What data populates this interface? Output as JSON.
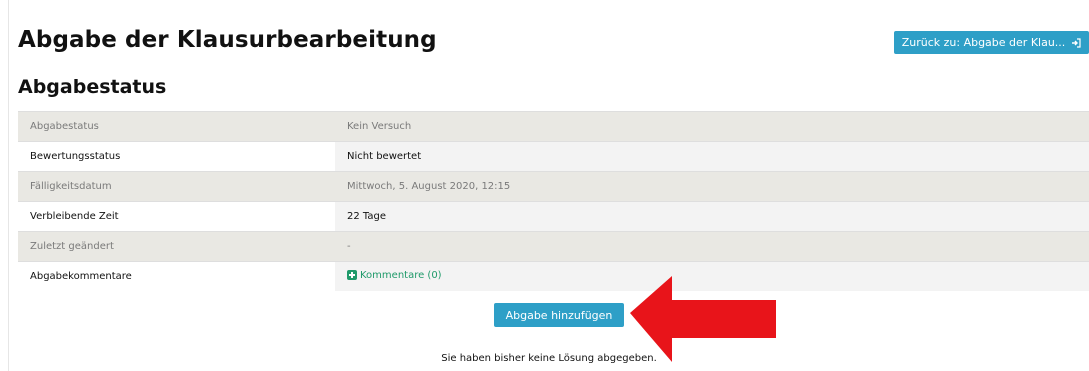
{
  "header": {
    "title": "Abgabe der Klausurbearbeitung",
    "back_button_label": "Zurück zu: Abgabe der Klau...",
    "back_icon": "sign-in-icon"
  },
  "section": {
    "title": "Abgabestatus"
  },
  "status_rows": [
    {
      "label": "Abgabestatus",
      "value": "Kein Versuch"
    },
    {
      "label": "Bewertungsstatus",
      "value": "Nicht bewertet"
    },
    {
      "label": "Fälligkeitsdatum",
      "value": "Mittwoch, 5. August 2020, 12:15"
    },
    {
      "label": "Verbleibende Zeit",
      "value": "22 Tage"
    },
    {
      "label": "Zuletzt geändert",
      "value": "-"
    },
    {
      "label": "Abgabekommentare",
      "value": "Kommentare (0)",
      "icon": "plus-square-icon"
    }
  ],
  "actions": {
    "add_submission_label": "Abgabe hinzufügen"
  },
  "footer_note": "Sie haben bisher keine Lösung abgegeben.",
  "annotation": {
    "arrow_color": "#e8141a",
    "arrow_icon": "red-arrow-pointing-left"
  },
  "colors": {
    "button": "#2e9fc7",
    "link": "#1f9a6a",
    "row_shaded": "#e9e8e3"
  }
}
